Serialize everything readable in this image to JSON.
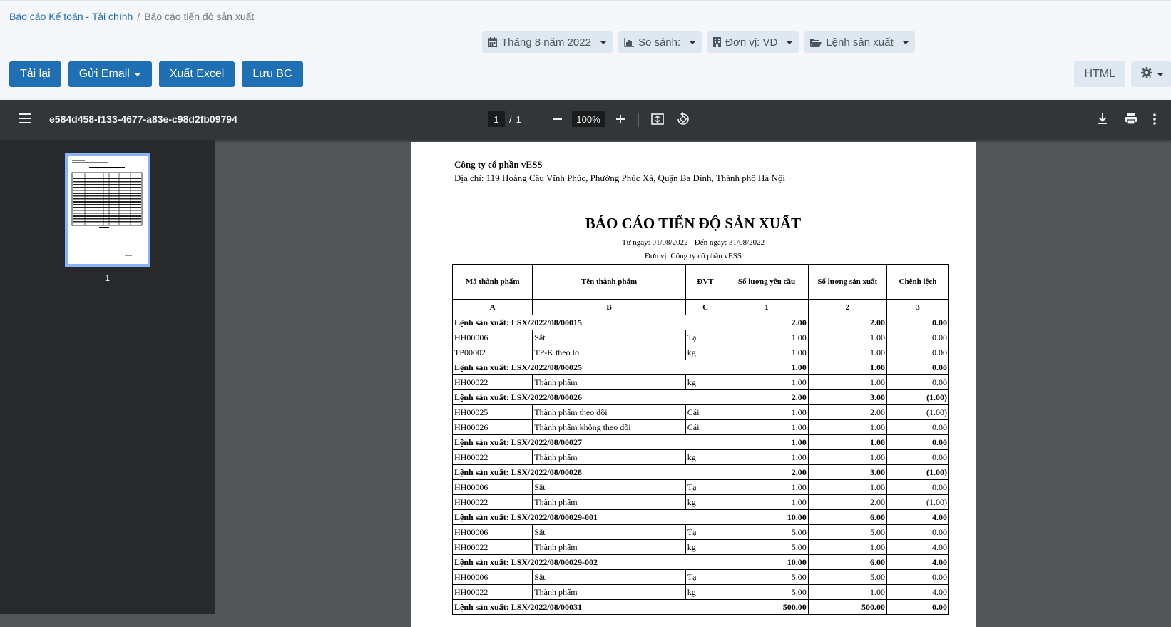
{
  "breadcrumb": {
    "parent": "Báo cáo Kế toán - Tài chính",
    "separator": "/",
    "current": "Báo cáo tiến độ sản xuất"
  },
  "filters": [
    {
      "icon": "calendar-icon",
      "label": "Tháng 8 năm 2022"
    },
    {
      "icon": "bar-chart-icon",
      "label": "So sánh:"
    },
    {
      "icon": "building-icon",
      "label": "Đơn vị: VD"
    },
    {
      "icon": "folder-open-icon",
      "label": "Lệnh sản xuất"
    }
  ],
  "actions": {
    "reload": "Tải lại",
    "email": "Gửi Email",
    "excel": "Xuất Excel",
    "save": "Lưu BC",
    "html": "HTML",
    "settings_icon": "gear-icon"
  },
  "viewer": {
    "doc_title": "e584d458-f133-4677-a83e-c98d2fb09794",
    "page_current": "1",
    "page_sep": "/",
    "page_total": "1",
    "zoom": "100%",
    "thumb_label": "1"
  },
  "report": {
    "company": "Công ty cổ phần vESS",
    "address": "Địa chỉ: 119 Hoàng Cầu Vĩnh Phúc, Phường Phúc Xá, Quận Ba Đình, Thành phố Hà Nội",
    "title": "BÁO CÁO TIẾN ĐỘ SẢN XUẤT",
    "date_range": "Từ ngày: 01/08/2022 - Đến ngày: 31/08/2022",
    "unit": "Đơn vị: Công ty cổ phần vESS",
    "columns": [
      "Mã thành phẩm",
      "Tên thành phẩm",
      "ĐVT",
      "Số lượng yêu cầu",
      "Số lượng sản xuất",
      "Chênh lệch"
    ],
    "letters": [
      "A",
      "B",
      "C",
      "1",
      "2",
      "3"
    ],
    "rows": [
      {
        "group": true,
        "label": "Lệnh sản xuất: LSX/2022/08/00015",
        "req": "2.00",
        "prod": "2.00",
        "diff": "0.00"
      },
      {
        "code": "HH00006",
        "name": "Sắt",
        "unit": "Tạ",
        "req": "1.00",
        "prod": "1.00",
        "diff": "0.00"
      },
      {
        "code": "TP00002",
        "name": "TP-K theo lô",
        "unit": "kg",
        "req": "1.00",
        "prod": "1.00",
        "diff": "0.00"
      },
      {
        "group": true,
        "label": "Lệnh sản xuất: LSX/2022/08/00025",
        "req": "1.00",
        "prod": "1.00",
        "diff": "0.00"
      },
      {
        "code": "HH00022",
        "name": "Thành phẩm",
        "unit": "kg",
        "req": "1.00",
        "prod": "1.00",
        "diff": "0.00"
      },
      {
        "group": true,
        "label": "Lệnh sản xuất: LSX/2022/08/00026",
        "req": "2.00",
        "prod": "3.00",
        "diff": "(1.00)"
      },
      {
        "code": "HH00025",
        "name": "Thành phẩm theo dõi",
        "unit": "Cái",
        "req": "1.00",
        "prod": "2.00",
        "diff": "(1.00)"
      },
      {
        "code": "HH00026",
        "name": "Thành phẩm không theo dõi",
        "unit": "Cái",
        "req": "1.00",
        "prod": "1.00",
        "diff": "0.00"
      },
      {
        "group": true,
        "label": "Lệnh sản xuất: LSX/2022/08/00027",
        "req": "1.00",
        "prod": "1.00",
        "diff": "0.00"
      },
      {
        "code": "HH00022",
        "name": "Thành phẩm",
        "unit": "kg",
        "req": "1.00",
        "prod": "1.00",
        "diff": "0.00"
      },
      {
        "group": true,
        "label": "Lệnh sản xuất: LSX/2022/08/00028",
        "req": "2.00",
        "prod": "3.00",
        "diff": "(1.00)"
      },
      {
        "code": "HH00006",
        "name": "Sắt",
        "unit": "Tạ",
        "req": "1.00",
        "prod": "1.00",
        "diff": "0.00"
      },
      {
        "code": "HH00022",
        "name": "Thành phẩm",
        "unit": "kg",
        "req": "1.00",
        "prod": "2.00",
        "diff": "(1.00)"
      },
      {
        "group": true,
        "label": "Lệnh sản xuất: LSX/2022/08/00029-001",
        "req": "10.00",
        "prod": "6.00",
        "diff": "4.00"
      },
      {
        "code": "HH00006",
        "name": "Sắt",
        "unit": "Tạ",
        "req": "5.00",
        "prod": "5.00",
        "diff": "0.00"
      },
      {
        "code": "HH00022",
        "name": "Thành phẩm",
        "unit": "kg",
        "req": "5.00",
        "prod": "1.00",
        "diff": "4.00"
      },
      {
        "group": true,
        "label": "Lệnh sản xuất: LSX/2022/08/00029-002",
        "req": "10.00",
        "prod": "6.00",
        "diff": "4.00"
      },
      {
        "code": "HH00006",
        "name": "Sắt",
        "unit": "Tạ",
        "req": "5.00",
        "prod": "5.00",
        "diff": "0.00"
      },
      {
        "code": "HH00022",
        "name": "Thành phẩm",
        "unit": "kg",
        "req": "5.00",
        "prod": "1.00",
        "diff": "4.00"
      },
      {
        "group": true,
        "label": "Lệnh sản xuất: LSX/2022/08/00031",
        "req": "500.00",
        "prod": "500.00",
        "diff": "0.00"
      }
    ]
  }
}
